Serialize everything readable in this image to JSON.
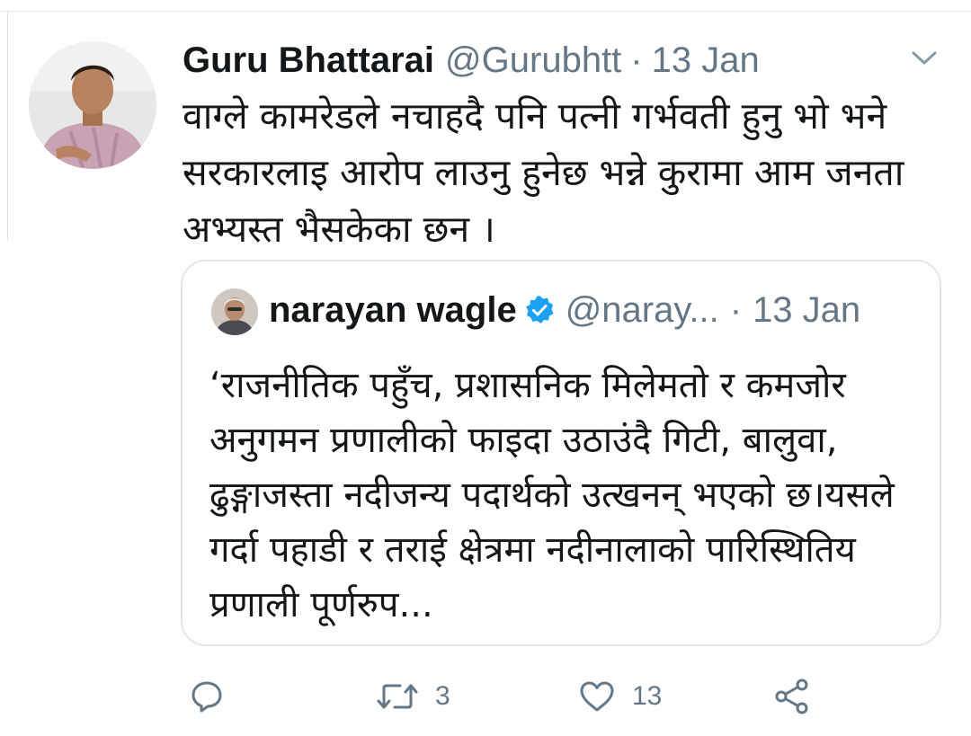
{
  "tweet": {
    "author_name": "Guru Bhattarai",
    "author_handle": "@Gurubhtt",
    "separator": "·",
    "date": "13 Jan",
    "text": "वाग्ले कामरेडले नचाहदै पनि पत्नी गर्भवती हुनु भो भने सरकारलाइ आरोप लाउनु हुनेछ भन्ने कुरामा आम जनता अभ्यस्त भैसकेका छन ।",
    "menu_icon": "chevron-down-icon"
  },
  "quoted_tweet": {
    "author_name": "narayan wagle",
    "verified_icon": "verified-badge-icon",
    "author_handle": "@naray...",
    "separator": "·",
    "date": "13 Jan",
    "text": "‘राजनीतिक पहुँच, प्रशासनिक मिलेमतो र कमजोर अनुगमन प्रणालीको फाइदा उठाउंदै गिटी, बालुवा, ढुङ्गाजस्ता नदीजन्य पदार्थको उत्खनन् भएको छ।यसले गर्दा पहाडी र तराई क्षेत्रमा नदीनालाको पारिस्थितिय प्रणाली पूर्णरुप..."
  },
  "actions": {
    "reply": {
      "icon": "reply-icon"
    },
    "retweet": {
      "icon": "retweet-icon",
      "count": "3"
    },
    "like": {
      "icon": "heart-icon",
      "count": "13"
    },
    "share": {
      "icon": "share-icon"
    }
  },
  "colors": {
    "text_primary": "#14171a",
    "text_secondary": "#657786",
    "verified_blue": "#1da1f2",
    "border": "#e1e8ed"
  }
}
